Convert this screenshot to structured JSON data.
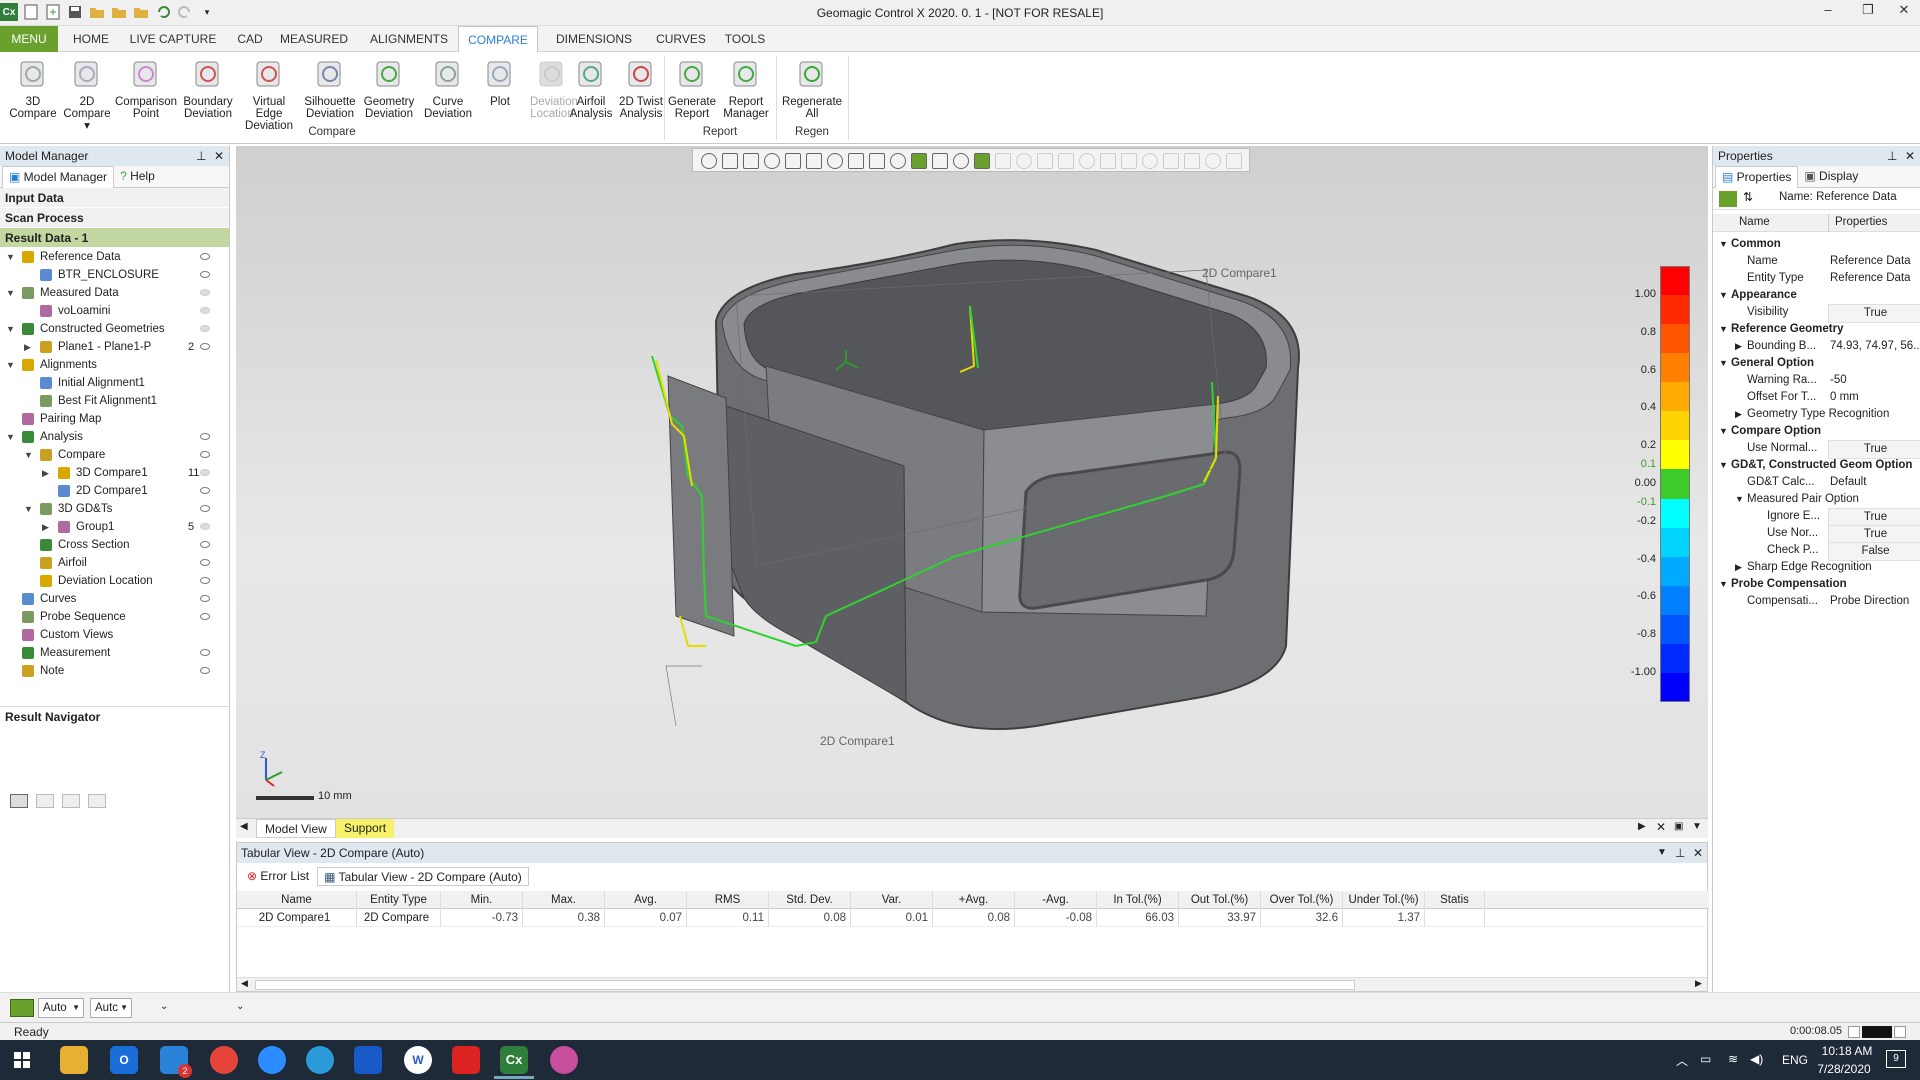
{
  "window": {
    "title": "Geomagic Control X 2020. 0. 1 - [NOT FOR RESALE]"
  },
  "ribbon_tabs": [
    "MENU",
    "HOME",
    "LIVE CAPTURE",
    "CAD",
    "MEASURED",
    "ALIGNMENTS",
    "COMPARE",
    "DIMENSIONS",
    "CURVES",
    "TOOLS"
  ],
  "active_tab": "COMPARE",
  "ribbon": {
    "compare_buttons": [
      {
        "l1": "3D",
        "l2": "Compare"
      },
      {
        "l1": "2D",
        "l2": "Compare ▾"
      },
      {
        "l1": "Comparison",
        "l2": "Point"
      },
      {
        "l1": "Boundary",
        "l2": "Deviation"
      },
      {
        "l1": "Virtual Edge",
        "l2": "Deviation"
      },
      {
        "l1": "Silhouette",
        "l2": "Deviation"
      },
      {
        "l1": "Geometry",
        "l2": "Deviation"
      },
      {
        "l1": "Curve",
        "l2": "Deviation"
      },
      {
        "l1": "Plot",
        "l2": ""
      },
      {
        "l1": "Deviation",
        "l2": "Location"
      },
      {
        "l1": "Airfoil",
        "l2": "Analysis"
      },
      {
        "l1": "2D Twist",
        "l2": "Analysis"
      }
    ],
    "report_buttons": [
      {
        "l1": "Generate",
        "l2": "Report"
      },
      {
        "l1": "Report",
        "l2": "Manager"
      }
    ],
    "regen_buttons": [
      {
        "l1": "Regenerate",
        "l2": "All"
      }
    ],
    "groups": {
      "compare": "Compare",
      "report": "Report",
      "regen": "Regen"
    }
  },
  "model_manager": {
    "title": "Model Manager",
    "tabs": [
      "Model Manager",
      "Help"
    ],
    "sections": {
      "input": "Input Data",
      "scan": "Scan Process",
      "result": "Result Data - 1",
      "navigator": "Result Navigator"
    },
    "tree": [
      {
        "label": "Reference Data",
        "level": 0,
        "expand": "▼",
        "icon": "reference-data-icon",
        "eye": true
      },
      {
        "label": "BTR_ENCLOSURE",
        "level": 1,
        "expand": "",
        "icon": "part-icon",
        "eye": true
      },
      {
        "label": "Measured Data",
        "level": 0,
        "expand": "▼",
        "icon": "measured-data-icon",
        "eye": false
      },
      {
        "label": "voLoamini",
        "level": 1,
        "expand": "",
        "icon": "point-cloud-icon",
        "eye": false
      },
      {
        "label": "Constructed Geometries",
        "level": 0,
        "expand": "▼",
        "icon": "constructed-geometry-icon",
        "eye": false
      },
      {
        "label": "Plane1 - Plane1-P",
        "level": 1,
        "expand": "▶",
        "icon": "plane-icon",
        "eye": true,
        "count": "2"
      },
      {
        "label": "Alignments",
        "level": 0,
        "expand": "▼",
        "icon": "alignment-icon",
        "eye": false,
        "noeye": true
      },
      {
        "label": "Initial Alignment1",
        "level": 1,
        "expand": "",
        "icon": "initial-alignment-icon",
        "noeye": true
      },
      {
        "label": "Best Fit Alignment1",
        "level": 1,
        "expand": "",
        "icon": "best-fit-icon",
        "noeye": true
      },
      {
        "label": "Pairing Map",
        "level": 0,
        "expand": "",
        "icon": "pairing-map-icon",
        "noeye": true
      },
      {
        "label": "Analysis",
        "level": 0,
        "expand": "▼",
        "icon": "analysis-icon",
        "eye": true
      },
      {
        "label": "Compare",
        "level": 1,
        "expand": "▼",
        "icon": "compare-icon",
        "eye": true
      },
      {
        "label": "3D Compare1",
        "level": 2,
        "expand": "▶",
        "icon": "3d-compare-icon",
        "eye": false,
        "count": "11"
      },
      {
        "label": "2D Compare1",
        "level": 2,
        "expand": "",
        "icon": "2d-compare-icon",
        "eye": true
      },
      {
        "label": "3D GD&Ts",
        "level": 1,
        "expand": "▼",
        "icon": "gdt-icon",
        "eye": true
      },
      {
        "label": "Group1",
        "level": 2,
        "expand": "▶",
        "icon": "group-icon",
        "eye": false,
        "count": "5"
      },
      {
        "label": "Cross Section",
        "level": 1,
        "expand": "",
        "icon": "cross-section-icon",
        "eye": true
      },
      {
        "label": "Airfoil",
        "level": 1,
        "expand": "",
        "icon": "airfoil-icon",
        "eye": true
      },
      {
        "label": "Deviation Location",
        "level": 1,
        "expand": "",
        "icon": "deviation-location-icon",
        "eye": true
      },
      {
        "label": "Curves",
        "level": 0,
        "expand": "",
        "icon": "curves-icon",
        "eye": true
      },
      {
        "label": "Probe Sequence",
        "level": 0,
        "expand": "",
        "icon": "probe-sequence-icon",
        "eye": true
      },
      {
        "label": "Custom Views",
        "level": 0,
        "expand": "",
        "icon": "custom-views-icon",
        "noeye": true
      },
      {
        "label": "Measurement",
        "level": 0,
        "expand": "",
        "icon": "measurement-icon",
        "eye": true
      },
      {
        "label": "Note",
        "level": 0,
        "expand": "",
        "icon": "note-icon",
        "eye": true
      }
    ]
  },
  "viewport": {
    "annotation_top": "2D Compare1",
    "annotation_bottom": "2D Compare1",
    "scale": "10 mm",
    "legend_labels": [
      "1.00",
      "0.8",
      "0.6",
      "0.4",
      "0.2",
      "0.1",
      "0.00",
      "-0.1",
      "-0.2",
      "-0.4",
      "-0.6",
      "-0.8",
      "-1.00"
    ],
    "legend_colors": [
      "#ff0000",
      "#ff2a00",
      "#ff5500",
      "#ff8000",
      "#ffaa00",
      "#ffd400",
      "#ffff00",
      "#3ccb2a",
      "#00ffff",
      "#00d4ff",
      "#00aaff",
      "#0080ff",
      "#0055ff",
      "#002aff",
      "#0000ff"
    ],
    "view_tabs": [
      "Model View",
      "Support"
    ]
  },
  "tabular": {
    "title": "Tabular View - 2D Compare (Auto)",
    "tabs": [
      "Error List",
      "Tabular View - 2D Compare (Auto)"
    ],
    "columns": [
      "Name",
      "Entity Type",
      "Min.",
      "Max.",
      "Avg.",
      "RMS",
      "Std. Dev.",
      "Var.",
      "+Avg.",
      "-Avg.",
      "In Tol.(%)",
      "Out Tol.(%)",
      "Over Tol.(%)",
      "Under Tol.(%)",
      "Statis"
    ],
    "rows": [
      [
        "2D Compare1",
        "2D Compare",
        "-0.73",
        "0.38",
        "0.07",
        "0.11",
        "0.08",
        "0.01",
        "0.08",
        "-0.08",
        "66.03",
        "33.97",
        "32.6",
        "1.37",
        ""
      ]
    ]
  },
  "properties": {
    "title": "Properties",
    "tabs": [
      "Properties",
      "Display"
    ],
    "name_line": "Name: Reference Data",
    "col_name": "Name",
    "col_props": "Properties",
    "rows": [
      {
        "type": "cat",
        "key": "Common"
      },
      {
        "type": "kv",
        "key": "Name",
        "val": "Reference Data"
      },
      {
        "type": "kv",
        "key": "Entity Type",
        "val": "Reference Data"
      },
      {
        "type": "cat",
        "key": "Appearance"
      },
      {
        "type": "kvc",
        "key": "Visibility",
        "val": "True"
      },
      {
        "type": "cat",
        "key": "Reference Geometry"
      },
      {
        "type": "kvx",
        "key": "Bounding B...",
        "val": "74.93, 74.97, 56..."
      },
      {
        "type": "cat",
        "key": "General Option"
      },
      {
        "type": "kv",
        "key": "Warning Ra...",
        "val": "-50"
      },
      {
        "type": "kv",
        "key": "Offset For T...",
        "val": "0 mm"
      },
      {
        "type": "sub",
        "key": "Geometry Type Recognition"
      },
      {
        "type": "cat",
        "key": "Compare Option"
      },
      {
        "type": "kvc",
        "key": "Use Normal...",
        "val": "True"
      },
      {
        "type": "cat",
        "key": "GD&T, Constructed Geom Option"
      },
      {
        "type": "kv",
        "key": "GD&T Calc...",
        "val": "Default"
      },
      {
        "type": "subo",
        "key": "Measured Pair Option"
      },
      {
        "type": "kvc2",
        "key": "Ignore E...",
        "val": "True"
      },
      {
        "type": "kvc2",
        "key": "Use Nor...",
        "val": "True"
      },
      {
        "type": "kvc2",
        "key": "Check P...",
        "val": "False"
      },
      {
        "type": "sub",
        "key": "Sharp Edge Recognition"
      },
      {
        "type": "cat",
        "key": "Probe Compensation"
      },
      {
        "type": "kv",
        "key": "Compensati...",
        "val": "Probe Direction"
      }
    ]
  },
  "bottom": {
    "auto1": "Auto",
    "auto2": "Autc",
    "status": "Ready",
    "timer": "0:00:08.05"
  },
  "taskbar": {
    "lang": "ENG",
    "time": "10:18 AM",
    "date": "7/28/2020",
    "notif": "9",
    "outlook_badge": "2"
  }
}
